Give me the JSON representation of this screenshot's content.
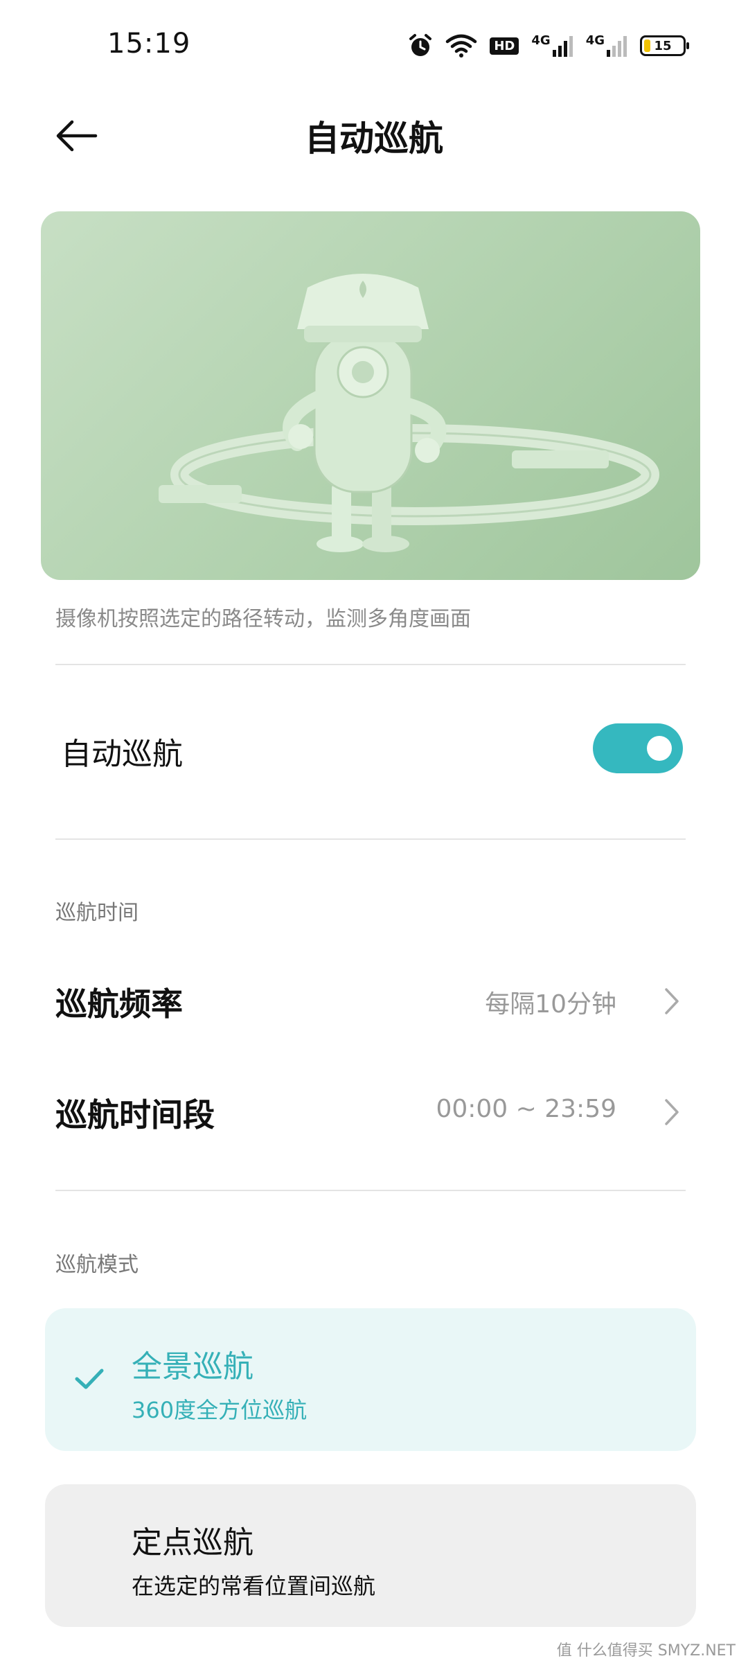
{
  "status_bar": {
    "time": "15:19",
    "icons": [
      "alarm-icon",
      "wifi-icon",
      "hd-icon",
      "signal-4g-icon",
      "signal-4g-icon",
      "battery-icon"
    ],
    "hd_label": "HD",
    "network_1": "4G",
    "network_2": "4G",
    "battery": "15",
    "battery_color": "#f2c200"
  },
  "header": {
    "back_icon": "arrow-left-icon",
    "title": "自动巡航"
  },
  "hero": {
    "caption": "摄像机按照选定的路径转动，监测多角度画面"
  },
  "auto_cruise": {
    "label": "自动巡航",
    "enabled": true,
    "accent_color": "#35b8bf"
  },
  "cruise_time": {
    "section_label": "巡航时间",
    "items": [
      {
        "title": "巡航频率",
        "value": "每隔10分钟",
        "icon": "chevron-right-icon"
      },
      {
        "title": "巡航时间段",
        "value": "00:00 ~ 23:59",
        "icon": "chevron-right-icon"
      }
    ]
  },
  "cruise_mode": {
    "section_label": "巡航模式",
    "options": [
      {
        "title": "全景巡航",
        "description": "360度全方位巡航",
        "selected": true,
        "icon": "check-icon"
      },
      {
        "title": "定点巡航",
        "description": "在选定的常看位置间巡航",
        "selected": false
      }
    ]
  },
  "watermark": "值 什么值得买 SMYZ.NET"
}
